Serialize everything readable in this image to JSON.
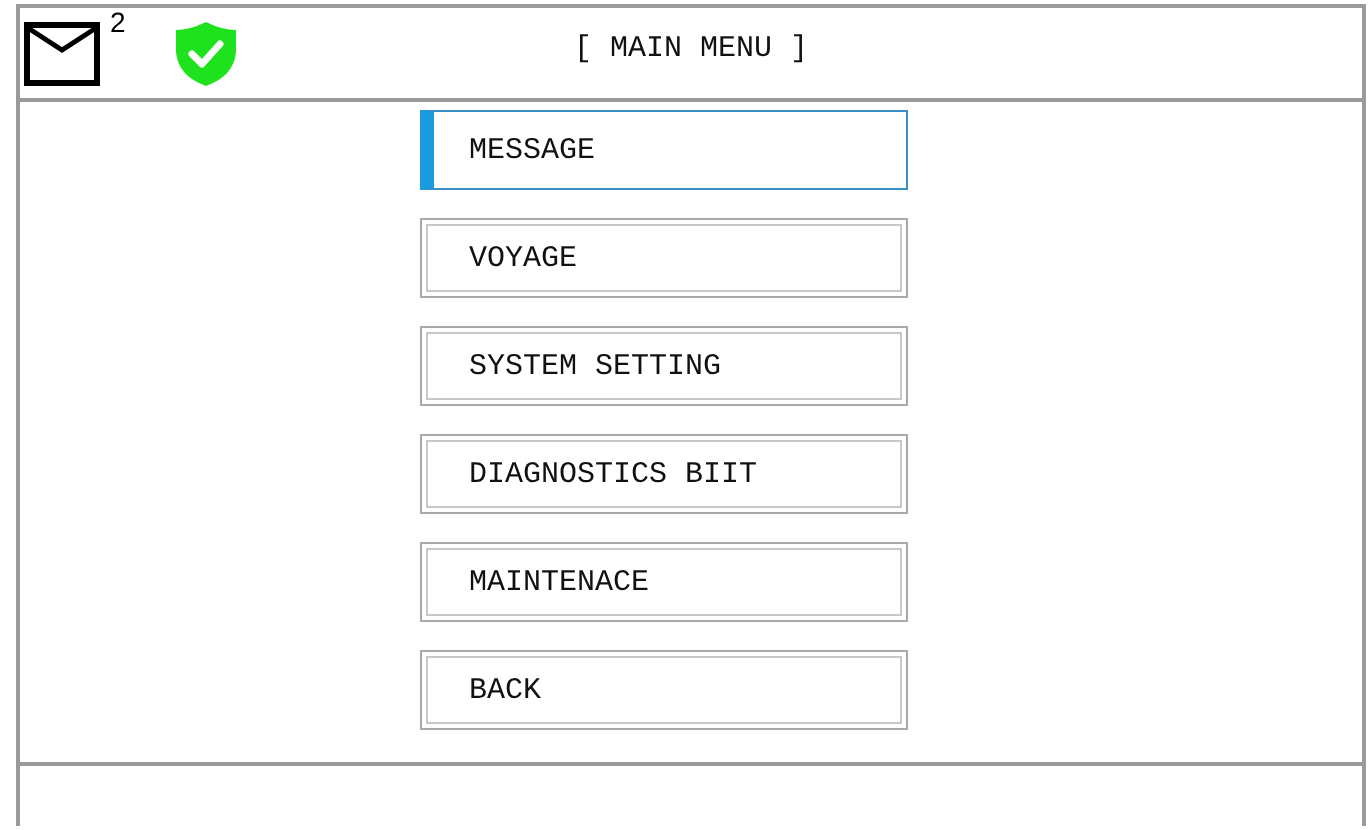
{
  "header": {
    "unread_count": "2",
    "title": "[ MAIN MENU ]",
    "secure": true
  },
  "menu": [
    {
      "label": "MESSAGE",
      "selected": true
    },
    {
      "label": "VOYAGE",
      "selected": false
    },
    {
      "label": "SYSTEM SETTING",
      "selected": false
    },
    {
      "label": "DIAGNOSTICS BIIT",
      "selected": false
    },
    {
      "label": "MAINTENACE",
      "selected": false
    },
    {
      "label": "BACK",
      "selected": false
    }
  ]
}
